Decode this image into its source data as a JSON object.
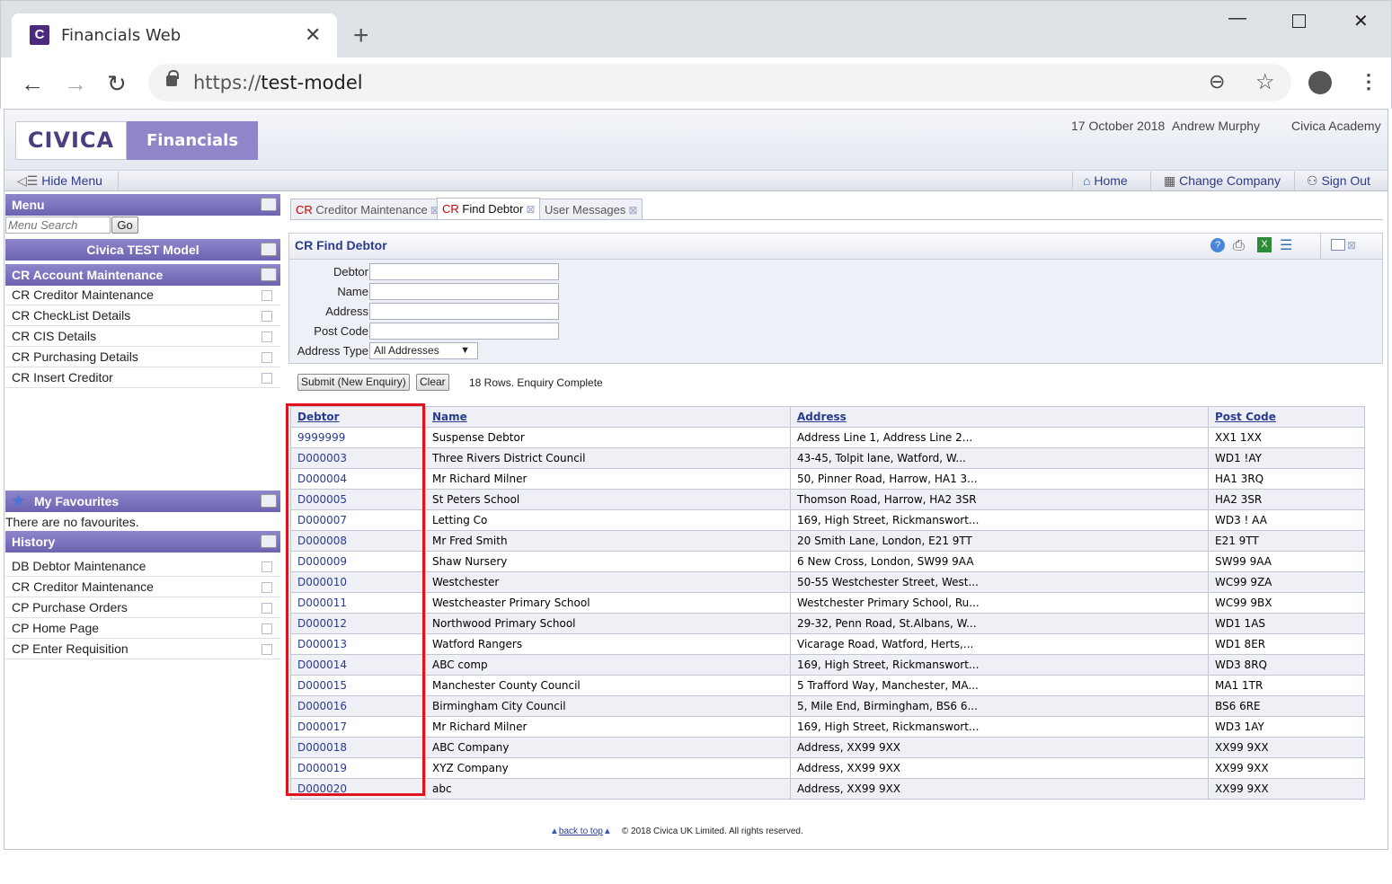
{
  "browser": {
    "tab_title": "Financials Web",
    "tab_favicon": "C",
    "url_proto": "https://",
    "url_host": "test-model"
  },
  "header": {
    "logo_civica": "CIVICA",
    "logo_product": "Financials Web",
    "date": "17 October 2018",
    "user": "Andrew Murphy",
    "org": "Civica Academy"
  },
  "menubar": {
    "hide_menu": "Hide Menu",
    "home": "Home",
    "change_company": "Change Company",
    "sign_out": "Sign Out"
  },
  "sidebar": {
    "menu_title": "Menu",
    "search_placeholder": "Menu Search",
    "go": "Go",
    "model_title": "Civica TEST Model",
    "section_title": "CR Account Maintenance",
    "items": [
      "CR Creditor Maintenance",
      "CR CheckList Details",
      "CR CIS Details",
      "CR Purchasing Details",
      "CR Insert Creditor"
    ],
    "favourites_title": "My Favourites",
    "favourites_empty": "There are no favourites.",
    "history_title": "History",
    "history": [
      "DB Debtor Maintenance",
      "CR Creditor Maintenance",
      "CP Purchase Orders",
      "CP Home Page",
      "CP Enter Requisition"
    ]
  },
  "tabs": [
    {
      "prefix": "CR",
      "label": "Creditor Maintenance"
    },
    {
      "prefix": "CR",
      "label": "Find Debtor"
    },
    {
      "prefix": "",
      "label": "User Messages"
    }
  ],
  "form": {
    "title": "CR Find Debtor",
    "debtor_label": "Debtor",
    "name_label": "Name",
    "address_label": "Address",
    "postcode_label": "Post Code",
    "address_type_label": "Address Type",
    "address_type_value": "All Addresses",
    "submit": "Submit (New Enquiry)",
    "clear": "Clear",
    "status": "18 Rows. Enquiry Complete"
  },
  "table": {
    "headers": [
      "Debtor",
      "Name",
      "Address",
      "Post Code"
    ],
    "rows": [
      [
        "9999999",
        "Suspense Debtor",
        "Address Line 1, Address Line 2...",
        "XX1 1XX"
      ],
      [
        "D000003",
        "Three Rivers District Council",
        "43-45, Tolpit lane, Watford, W...",
        "WD1 !AY"
      ],
      [
        "D000004",
        "Mr Richard Milner",
        "50, Pinner Road, Harrow, HA1 3...",
        "HA1 3RQ"
      ],
      [
        "D000005",
        "St Peters School",
        "Thomson Road, Harrow, HA2 3SR",
        "HA2 3SR"
      ],
      [
        "D000007",
        "Letting Co",
        "169, High Street, Rickmanswort...",
        "WD3 ! AA"
      ],
      [
        "D000008",
        "Mr Fred Smith",
        "20 Smith Lane, London, E21 9TT",
        "E21 9TT"
      ],
      [
        "D000009",
        "Shaw Nursery",
        "6 New Cross, London, SW99 9AA",
        "SW99 9AA"
      ],
      [
        "D000010",
        "Westchester",
        "50-55 Westchester Street, West...",
        "WC99 9ZA"
      ],
      [
        "D000011",
        "Westcheaster Primary School",
        "Westchester Primary School, Ru...",
        "WC99 9BX"
      ],
      [
        "D000012",
        "Northwood Primary School",
        "29-32, Penn Road, St.Albans, W...",
        "WD1 1AS"
      ],
      [
        "D000013",
        "Watford Rangers",
        "Vicarage Road, Watford, Herts,...",
        "WD1 8ER"
      ],
      [
        "D000014",
        "ABC comp",
        "169, High Street, Rickmanswort...",
        "WD3 8RQ"
      ],
      [
        "D000015",
        "Manchester County Council",
        "5 Trafford Way, Manchester, MA...",
        "MA1 1TR"
      ],
      [
        "D000016",
        "Birmingham City Council",
        "5, Mile End, Birmingham, BS6 6...",
        "BS6 6RE"
      ],
      [
        "D000017",
        "Mr Richard Milner",
        "169, High Street, Rickmanswort...",
        "WD3 1AY"
      ],
      [
        "D000018",
        "ABC Company",
        "Address, XX99 9XX",
        "XX99 9XX"
      ],
      [
        "D000019",
        "XYZ Company",
        "Address, XX99 9XX",
        "XX99 9XX"
      ],
      [
        "D000020",
        "abc",
        "Address, XX99 9XX",
        "XX99 9XX"
      ]
    ]
  },
  "footer": {
    "back_to_top": "back to top",
    "copyright": "© 2018 Civica UK Limited. All rights reserved."
  },
  "colors": {
    "accent": "#6c63b1",
    "link": "#2a3b8f",
    "highlight": "#e0141e"
  }
}
